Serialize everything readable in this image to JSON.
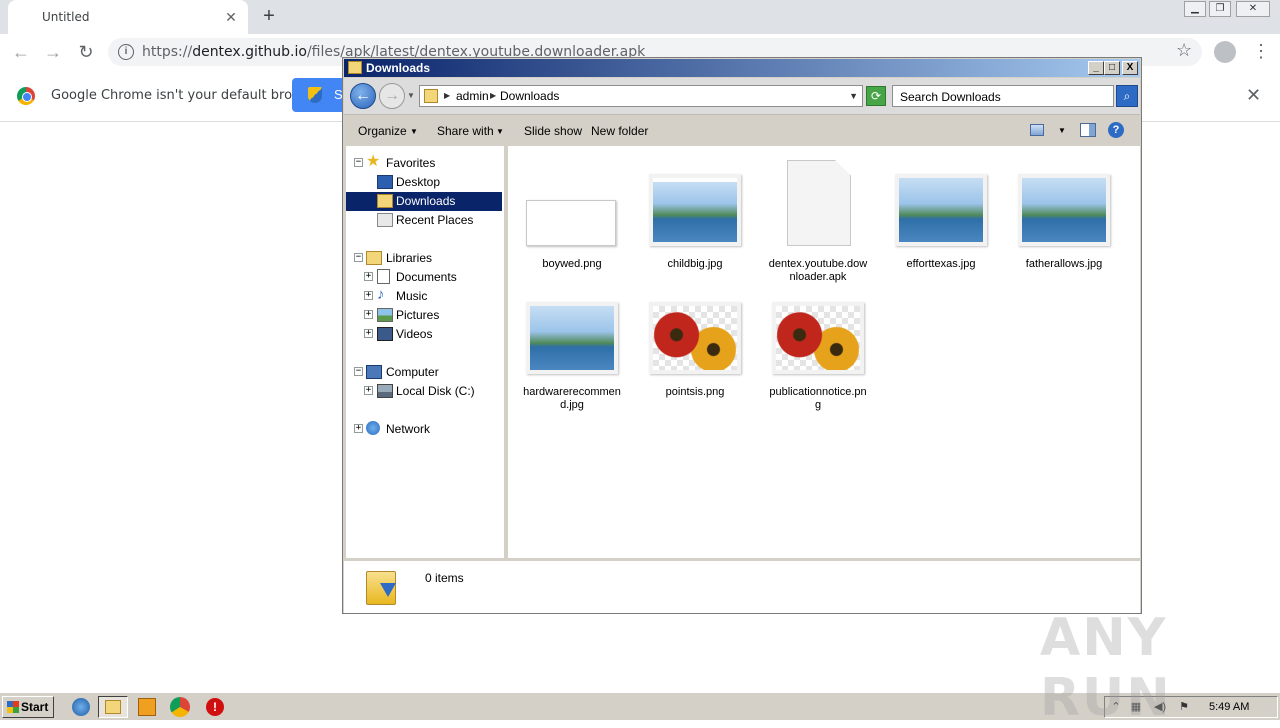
{
  "browser": {
    "tab_title": "Untitled",
    "tab_close": "✕",
    "new_tab": "+",
    "url_scheme": "https://",
    "url_host": "dentex.github.io",
    "url_path": "/files/apk/latest/dentex.youtube.downloader.apk",
    "infobar_text": "Google Chrome isn't your default browser",
    "set_default_partial": "S",
    "infobar_close": "✕",
    "window_controls": [
      "▁",
      "❐",
      "✕"
    ]
  },
  "explorer": {
    "title": "Downloads",
    "title_buttons": [
      "_",
      "□",
      "X"
    ],
    "breadcrumbs": [
      "admin",
      "Downloads"
    ],
    "search_placeholder": "Search Downloads",
    "commands": {
      "organize": "Organize",
      "share_with": "Share with",
      "slide_show": "Slide show",
      "new_folder": "New folder"
    },
    "tree": {
      "favorites": "Favorites",
      "desktop": "Desktop",
      "downloads": "Downloads",
      "recent_places": "Recent Places",
      "libraries": "Libraries",
      "documents": "Documents",
      "music": "Music",
      "pictures": "Pictures",
      "videos": "Videos",
      "computer": "Computer",
      "local_disk": "Local Disk (C:)",
      "network": "Network"
    },
    "files": [
      {
        "name": "boywed.png",
        "thumb": "blank"
      },
      {
        "name": "childbig.jpg",
        "thumb": "landscape"
      },
      {
        "name": "dentex.youtube.downloader.apk",
        "thumb": "document"
      },
      {
        "name": "efforttexas.jpg",
        "thumb": "landscape"
      },
      {
        "name": "fatherallows.jpg",
        "thumb": "landscape"
      },
      {
        "name": "hardwarerecommend.jpg",
        "thumb": "landscape"
      },
      {
        "name": "pointsis.png",
        "thumb": "flowers"
      },
      {
        "name": "publicationnotice.png",
        "thumb": "flowers"
      }
    ],
    "status": "0 items"
  },
  "taskbar": {
    "start_label": "Start",
    "clock": "5:49 AM"
  },
  "watermark": "ANY  RUN"
}
